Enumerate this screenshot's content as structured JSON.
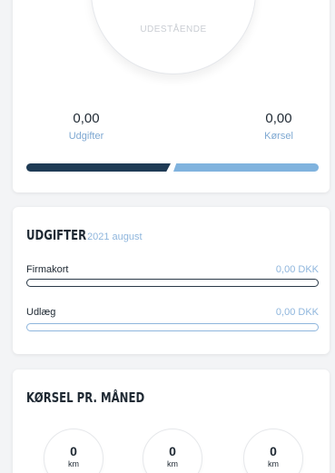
{
  "summary": {
    "donut_label": "UDESTÅENDE",
    "expenses_value": "0,00",
    "expenses_label": "Udgifter",
    "driving_value": "0,00",
    "driving_label": "Kørsel",
    "colors": {
      "dark": "#1f3b55",
      "light": "#80b3de"
    }
  },
  "expenses": {
    "title": "UDGIFTER",
    "period": "2021 august",
    "rows": [
      {
        "label": "Firmakort",
        "value": "0,00 DKK"
      },
      {
        "label": "Udlæg",
        "value": "0,00 DKK"
      }
    ]
  },
  "driving": {
    "title": "KØRSEL PR. MÅNED",
    "months": [
      {
        "value": "0",
        "unit": "km"
      },
      {
        "value": "0",
        "unit": "km"
      },
      {
        "value": "0",
        "unit": "km"
      }
    ]
  }
}
